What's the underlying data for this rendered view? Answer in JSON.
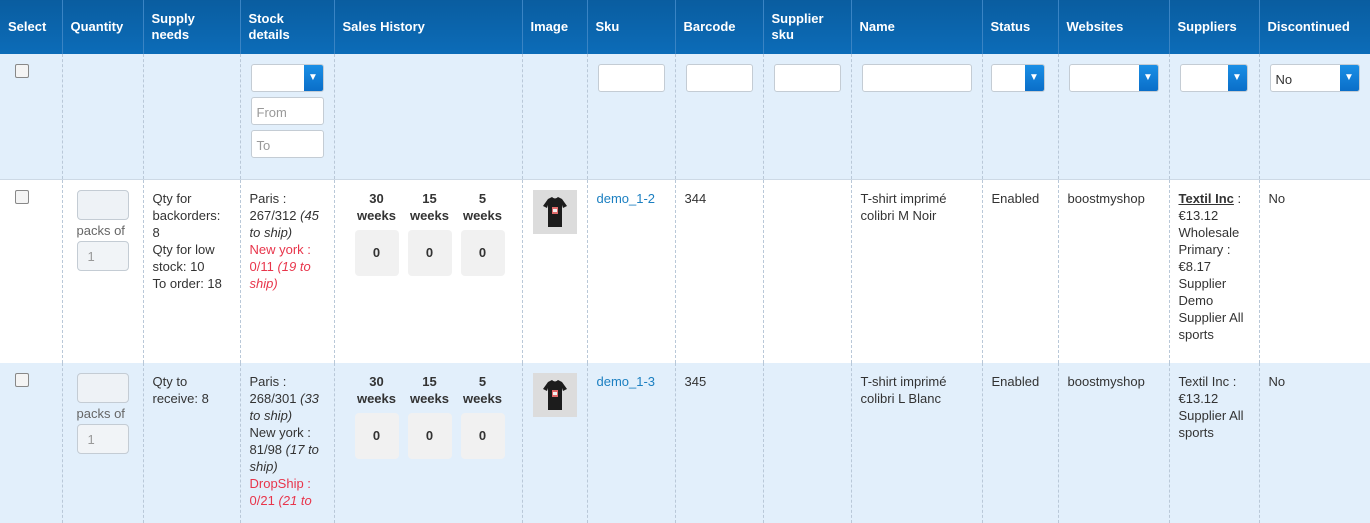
{
  "columns": {
    "select": "Select",
    "quantity": "Quantity",
    "supply_needs": "Supply needs",
    "stock_details": "Stock details",
    "sales_history": "Sales History",
    "image": "Image",
    "sku": "Sku",
    "barcode": "Barcode",
    "supplier_sku": "Supplier sku",
    "name": "Name",
    "status": "Status",
    "websites": "Websites",
    "suppliers": "Suppliers",
    "discontinued": "Discontinued"
  },
  "filters": {
    "from_placeholder": "From",
    "to_placeholder": "To",
    "discontinued_value": "No"
  },
  "rows": [
    {
      "packs_label": "packs of",
      "pack_value": "1",
      "supply": [
        "Qty for backorders: 8",
        "Qty for low stock: 10",
        "To order: 18"
      ],
      "stock": [
        {
          "loc": "Paris :",
          "val": "267/312",
          "ship": "(45 to ship)",
          "red": false
        },
        {
          "loc": "New york :",
          "val": "0/11",
          "ship": "(19 to ship)",
          "red": true
        }
      ],
      "weeks": [
        {
          "label": "30 weeks",
          "value": "0"
        },
        {
          "label": "15 weeks",
          "value": "0"
        },
        {
          "label": "5 weeks",
          "value": "0"
        }
      ],
      "sku": "demo_1-2",
      "barcode": "344",
      "supplier_sku": "",
      "name": "T-shirt imprimé colibri M Noir",
      "status": "Enabled",
      "website": "boostmyshop",
      "supplier1_name": "Textil Inc",
      "supplier1_rest": ": €13.12",
      "supplier2": "Wholesale Primary : €8.17",
      "supplier3": "Supplier Demo",
      "supplier4": "Supplier All sports",
      "discontinued": "No"
    },
    {
      "packs_label": "packs of",
      "pack_value": "1",
      "supply": [
        "Qty to receive: 8"
      ],
      "stock": [
        {
          "loc": "Paris :",
          "val": "268/301",
          "ship": "(33 to ship)",
          "red": false
        },
        {
          "loc": "New york :",
          "val": "81/98",
          "ship": "(17 to ship)",
          "red": false
        },
        {
          "loc": "DropShip :",
          "val": "0/21",
          "ship": "(21 to",
          "red": true
        }
      ],
      "weeks": [
        {
          "label": "30 weeks",
          "value": "0"
        },
        {
          "label": "15 weeks",
          "value": "0"
        },
        {
          "label": "5 weeks",
          "value": "0"
        }
      ],
      "sku": "demo_1-3",
      "barcode": "345",
      "supplier_sku": "",
      "name": "T-shirt imprimé colibri L Blanc",
      "status": "Enabled",
      "website": "boostmyshop",
      "supplier1_name": "Textil Inc",
      "supplier1_rest": ": €13.12",
      "supplier2": "",
      "supplier3": "",
      "supplier4": "Supplier All sports",
      "discontinued": "No"
    }
  ]
}
